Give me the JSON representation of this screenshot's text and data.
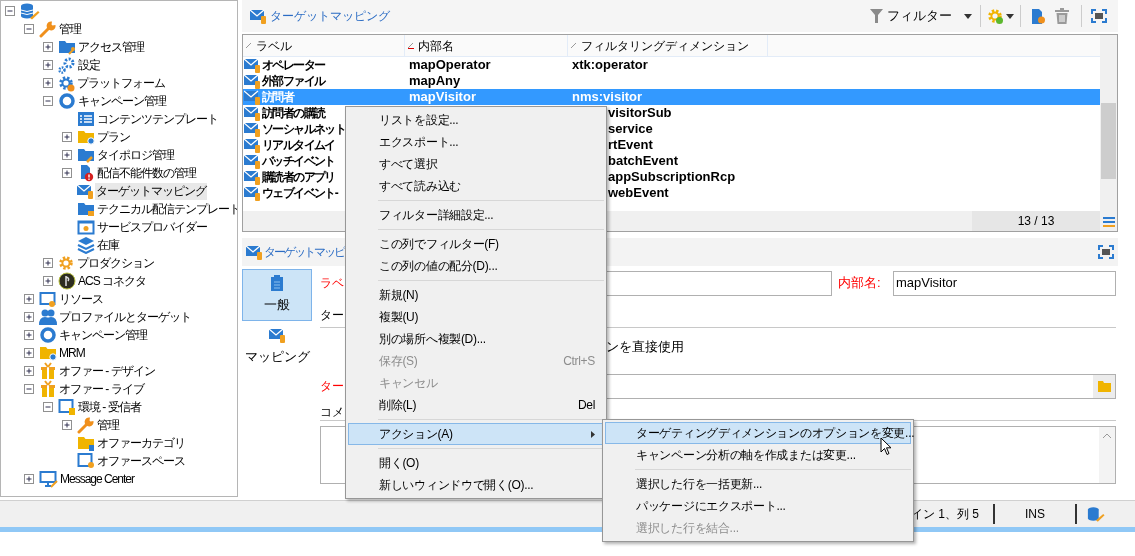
{
  "tree": [
    {
      "kind": "database",
      "has_children": true,
      "expanded": true,
      "children": [
        {
          "label": "管理",
          "kind": "admin",
          "has_children": true,
          "expanded": true,
          "selected": false,
          "children": [
            {
              "label": "アクセス管理",
              "kind": "access",
              "has_children": true,
              "expanded": false,
              "selected": false
            },
            {
              "label": "設定",
              "kind": "settings",
              "has_children": true,
              "expanded": false,
              "selected": false
            },
            {
              "label": "プラットフォーム",
              "kind": "platform",
              "has_children": true,
              "expanded": false,
              "selected": false
            },
            {
              "label": "キャンペーン管理",
              "kind": "campaign",
              "has_children": true,
              "expanded": true,
              "selected": false,
              "children": [
                {
                  "label": "コンテンツテンプレート",
                  "kind": "template",
                  "has_children": false,
                  "selected": false
                },
                {
                  "label": "プラン",
                  "kind": "plan",
                  "has_children": true,
                  "expanded": false,
                  "selected": false
                },
                {
                  "label": "タイポロジ管理",
                  "kind": "typology",
                  "has_children": true,
                  "expanded": false,
                  "selected": false
                },
                {
                  "label": "配信不能件数の管理",
                  "kind": "quarantine",
                  "has_children": true,
                  "expanded": false,
                  "selected": false
                },
                {
                  "label": "ターゲットマッピング",
                  "kind": "mapping",
                  "has_children": false,
                  "selected": true
                },
                {
                  "label": "テクニカル配信テンプレート",
                  "kind": "delivery",
                  "has_children": false,
                  "selected": false
                },
                {
                  "label": "サービスプロバイダー",
                  "kind": "provider",
                  "has_children": false,
                  "selected": false
                },
                {
                  "label": "在庫",
                  "kind": "stock",
                  "has_children": false,
                  "selected": false
                }
              ]
            },
            {
              "label": "プロダクション",
              "kind": "production",
              "has_children": true,
              "expanded": false,
              "selected": false
            },
            {
              "label": "ACS コネクタ",
              "kind": "connector",
              "has_children": true,
              "expanded": false,
              "selected": false
            }
          ]
        },
        {
          "label": "リソース",
          "kind": "resources",
          "has_children": true,
          "expanded": false,
          "selected": false
        },
        {
          "label": "プロファイルとターゲット",
          "kind": "profiles",
          "has_children": true,
          "expanded": false,
          "selected": false
        },
        {
          "label": "キャンペーン管理",
          "kind": "campaign",
          "has_children": true,
          "expanded": false,
          "selected": false
        },
        {
          "label": "MRM",
          "kind": "mrm",
          "has_children": true,
          "expanded": false,
          "selected": false
        },
        {
          "label": "オファー - デザイン",
          "kind": "offer",
          "has_children": true,
          "expanded": false,
          "selected": false
        },
        {
          "label": "オファー - ライブ",
          "kind": "offer",
          "has_children": true,
          "expanded": true,
          "selected": false,
          "children": [
            {
              "label": "環境 - 受信者",
              "kind": "environment",
              "has_children": true,
              "expanded": true,
              "selected": false,
              "children": [
                {
                  "label": "管理",
                  "kind": "admin",
                  "has_children": true,
                  "expanded": false,
                  "selected": false
                },
                {
                  "label": "オファーカテゴリ",
                  "kind": "category",
                  "has_children": false,
                  "selected": false
                },
                {
                  "label": "オファースペース",
                  "kind": "space",
                  "has_children": false,
                  "selected": false
                }
              ]
            }
          ]
        },
        {
          "label": "Message Center",
          "kind": "message-center",
          "has_children": true,
          "expanded": false,
          "selected": false
        }
      ]
    }
  ],
  "list_panel": {
    "title": "ターゲットマッピング",
    "filter_button": "フィルター",
    "count": "13 / 13",
    "columns": [
      "ラベル",
      "内部名",
      "フィルタリングディメンション"
    ],
    "rows": [
      {
        "label": "オペレーター",
        "internal_name": "mapOperator",
        "filter_dimension": "xtk:operator",
        "selected": false
      },
      {
        "label": "外部ファイル",
        "internal_name": "mapAny",
        "selected": false
      },
      {
        "label": "訪問者",
        "internal_name": "mapVisitor",
        "filter_dimension": "nms:visitor",
        "selected": true
      },
      {
        "label": "訪問者の購読",
        "filter_dimension": "visitorSub",
        "selected": false
      },
      {
        "label": "ソーシャルネット",
        "filter_dimension": "service",
        "selected": false
      },
      {
        "label": "リアルタイムイ",
        "filter_dimension": "rtEvent",
        "selected": false
      },
      {
        "label": "バッチイベント",
        "filter_dimension": "batchEvent",
        "selected": false
      },
      {
        "label": "購読者のアプリ",
        "filter_dimension": "appSubscriptionRcp",
        "selected": false
      },
      {
        "label": "ウェブイベント-",
        "filter_dimension": "webEvent",
        "selected": false
      }
    ]
  },
  "detail_panel": {
    "title": "ターゲットマッピ",
    "tabs": [
      {
        "label": "一般",
        "selected": true
      },
      {
        "label": "マッピング",
        "selected": false
      }
    ],
    "label_caption": "ラベ",
    "internal_name_caption": "内部名:",
    "internal_name_value": "mapVisitor",
    "target_caption": "ター",
    "direct_use_text": "ンを直接使用",
    "target_field_caption": "ター",
    "comment_caption": "コメ"
  },
  "context_menu": {
    "items": [
      {
        "kind": "item",
        "label": "リストを設定...",
        "disabled": false,
        "selected": false
      },
      {
        "kind": "item",
        "label": "エクスポート...",
        "disabled": false,
        "selected": false
      },
      {
        "kind": "item",
        "label": "すべて選択",
        "disabled": false,
        "selected": false
      },
      {
        "kind": "item",
        "label": "すべて読み込む",
        "disabled": false,
        "selected": false
      },
      {
        "kind": "separator"
      },
      {
        "kind": "item",
        "label": "フィルター詳細設定...",
        "disabled": false,
        "selected": false
      },
      {
        "kind": "separator"
      },
      {
        "kind": "item",
        "label": "この列でフィルター(F)",
        "disabled": false,
        "selected": false
      },
      {
        "kind": "item",
        "label": "この列の値の配分(D)...",
        "disabled": false,
        "selected": false
      },
      {
        "kind": "separator"
      },
      {
        "kind": "item",
        "label": "新規(N)",
        "disabled": false,
        "selected": false
      },
      {
        "kind": "item",
        "label": "複製(U)",
        "disabled": false,
        "selected": false
      },
      {
        "kind": "item",
        "label": "別の場所へ複製(D)...",
        "disabled": false,
        "selected": false
      },
      {
        "kind": "item",
        "label": "保存(S)",
        "shortcut": "Ctrl+S",
        "disabled": true,
        "selected": false
      },
      {
        "kind": "item",
        "label": "キャンセル",
        "disabled": true,
        "selected": false
      },
      {
        "kind": "item",
        "label": "削除(L)",
        "shortcut": "Del",
        "disabled": false,
        "selected": false
      },
      {
        "kind": "separator"
      },
      {
        "kind": "submenu",
        "label": "アクション(A)",
        "disabled": false,
        "selected": true
      },
      {
        "kind": "separator"
      },
      {
        "kind": "item",
        "label": "開く(O)",
        "disabled": false,
        "selected": false
      },
      {
        "kind": "item",
        "label": "新しいウィンドウで開く(O)...",
        "disabled": false,
        "selected": false
      }
    ]
  },
  "submenu": {
    "items": [
      {
        "kind": "item",
        "label": "ターゲティングディメンションのオプションを変更...",
        "disabled": false,
        "selected": true
      },
      {
        "kind": "item",
        "label": "キャンペーン分析の軸を作成または変更...",
        "disabled": false,
        "selected": false
      },
      {
        "kind": "separator"
      },
      {
        "kind": "item",
        "label": "選択した行を一括更新...",
        "disabled": false,
        "selected": false
      },
      {
        "kind": "item",
        "label": "パッケージにエクスポート...",
        "disabled": false,
        "selected": false
      },
      {
        "kind": "item",
        "label": "選択した行を結合...",
        "disabled": true,
        "selected": false
      }
    ]
  },
  "status_bar": {
    "position": "イン 1、列 5",
    "mode": "INS"
  }
}
